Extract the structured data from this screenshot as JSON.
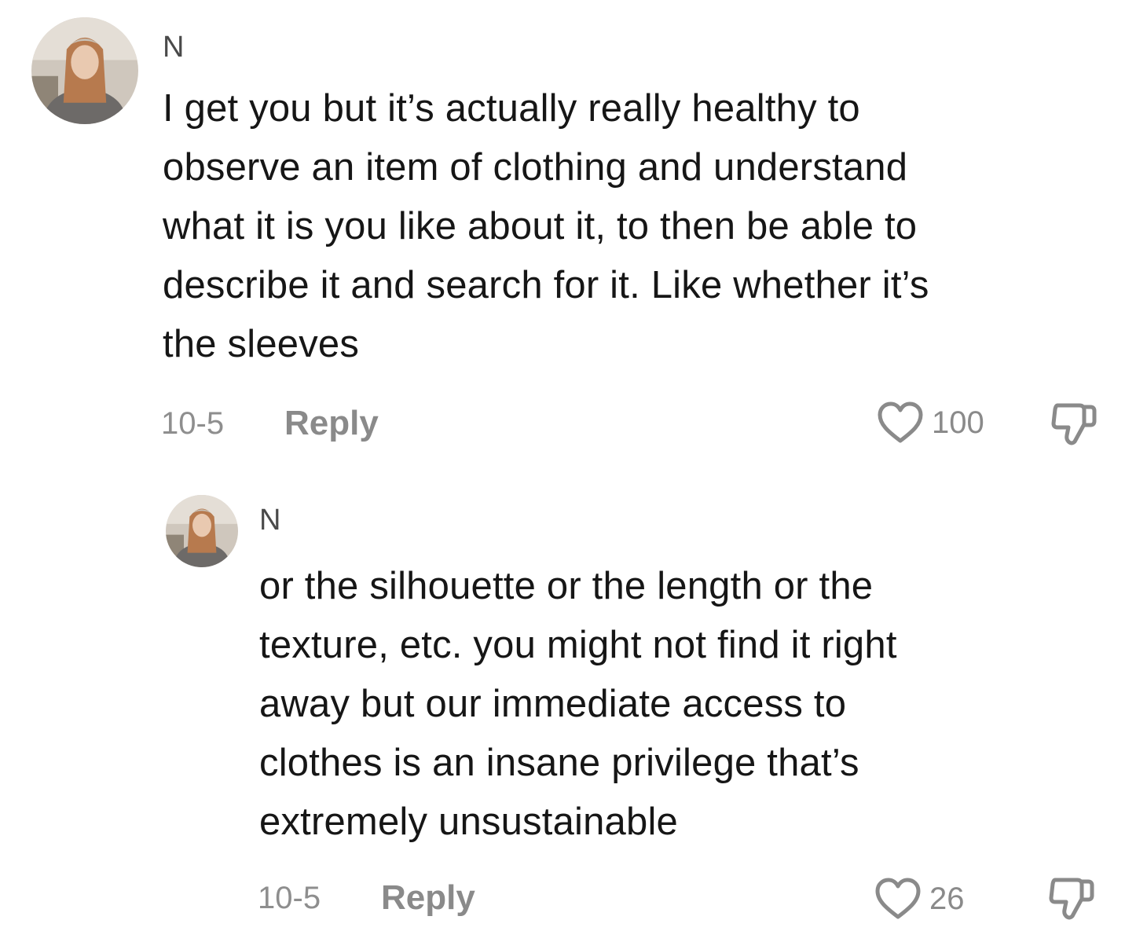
{
  "comments": [
    {
      "username": "N",
      "lines": [
        "I get you but it’s actually really healthy to",
        "observe an item of clothing and understand",
        "what it is you like about it, to then be able to",
        "describe it and search for it. Like whether it’s",
        "the sleeves"
      ],
      "date": "10-5",
      "reply_label": "Reply",
      "likes": "100",
      "avatar_icon": "profile-photo",
      "like_icon": "heart-outline-icon",
      "dislike_icon": "thumbs-down-icon"
    },
    {
      "username": "N",
      "lines": [
        "or the silhouette or the length or the",
        "texture, etc. you might not find it right",
        "away but our immediate access to",
        "clothes is an insane privilege that’s",
        "extremely unsustainable"
      ],
      "date": "10-5",
      "reply_label": "Reply",
      "likes": "26",
      "avatar_icon": "profile-photo",
      "like_icon": "heart-outline-icon",
      "dislike_icon": "thumbs-down-icon"
    }
  ]
}
